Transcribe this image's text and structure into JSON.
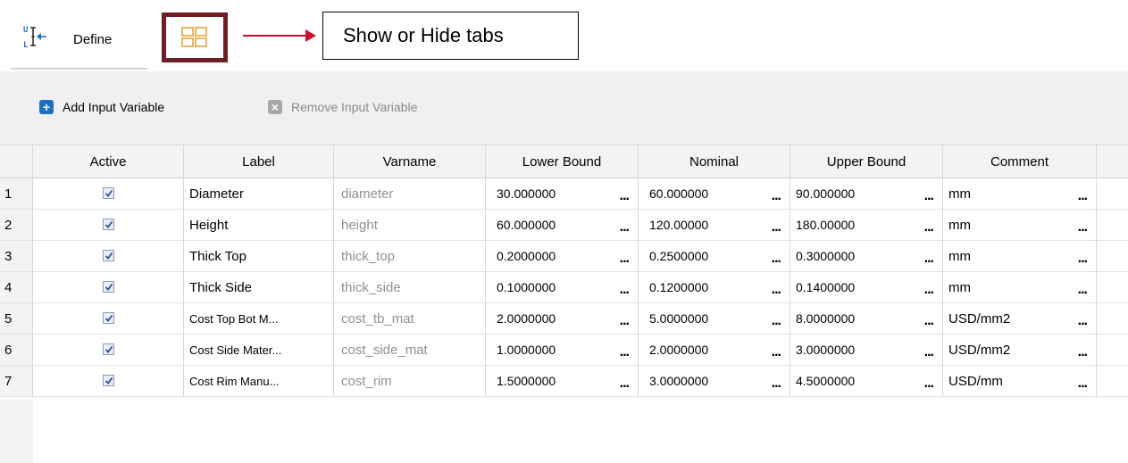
{
  "tabs": {
    "define_label": "Define"
  },
  "callout": {
    "text": "Show or Hide tabs"
  },
  "toolbar": {
    "add_label": "Add Input Variable",
    "remove_label": "Remove Input Variable"
  },
  "table": {
    "headers": [
      "Active",
      "Label",
      "Varname",
      "Lower Bound",
      "Nominal",
      "Upper Bound",
      "Comment"
    ],
    "ellipsis": "...",
    "rows": [
      {
        "n": "1",
        "active": true,
        "label": "Diameter",
        "varname": "diameter",
        "lower": "30.000000",
        "nominal": "60.000000",
        "upper": "90.000000",
        "comment": "mm"
      },
      {
        "n": "2",
        "active": true,
        "label": "Height",
        "varname": "height",
        "lower": "60.000000",
        "nominal": "120.00000",
        "upper": "180.00000",
        "comment": "mm"
      },
      {
        "n": "3",
        "active": true,
        "label": "Thick Top",
        "varname": "thick_top",
        "lower": "0.2000000",
        "nominal": "0.2500000",
        "upper": "0.3000000",
        "comment": "mm"
      },
      {
        "n": "4",
        "active": true,
        "label": "Thick Side",
        "varname": "thick_side",
        "lower": "0.1000000",
        "nominal": "0.1200000",
        "upper": "0.1400000",
        "comment": "mm"
      },
      {
        "n": "5",
        "active": true,
        "label": "Cost Top Bot M...",
        "varname": "cost_tb_mat",
        "lower": "2.0000000",
        "nominal": "5.0000000",
        "upper": "8.0000000",
        "comment": "USD/mm2"
      },
      {
        "n": "6",
        "active": true,
        "label": "Cost Side Mater...",
        "varname": "cost_side_mat",
        "lower": "1.0000000",
        "nominal": "2.0000000",
        "upper": "3.0000000",
        "comment": "USD/mm2"
      },
      {
        "n": "7",
        "active": true,
        "label": "Cost Rim Manu...",
        "varname": "cost_rim",
        "lower": "1.5000000",
        "nominal": "3.0000000",
        "upper": "4.5000000",
        "comment": "USD/mm"
      }
    ]
  },
  "colors": {
    "accent": "#1b6fc4",
    "callout_border": "#6d1f24",
    "arrow": "#c8102e"
  },
  "icons": [
    "define-variables-icon",
    "tabs-grid-icon",
    "add-icon",
    "remove-icon",
    "checkbox-checked-icon"
  ]
}
